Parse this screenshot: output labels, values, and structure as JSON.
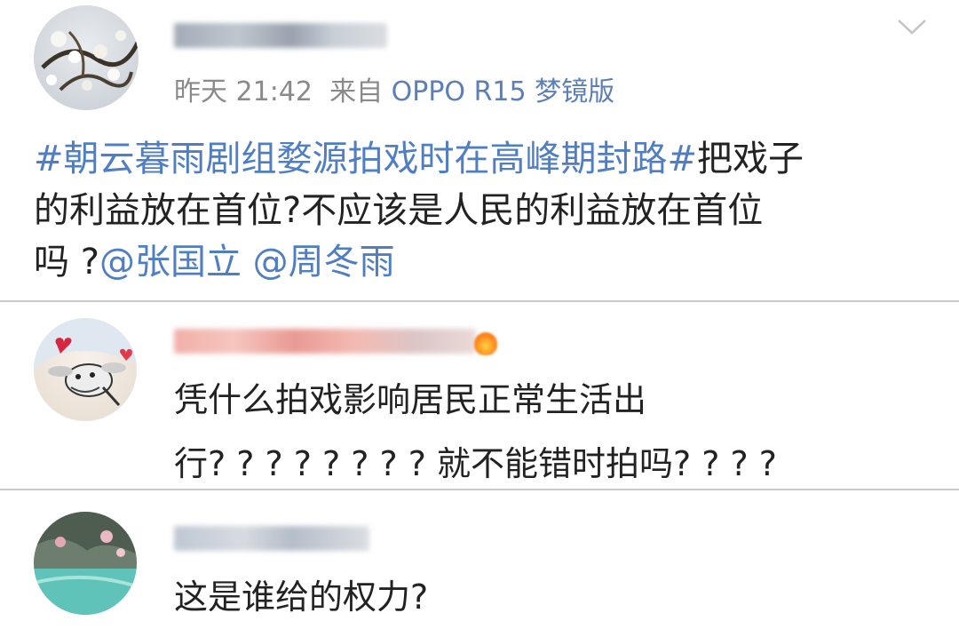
{
  "post": {
    "time": "昨天 21:42",
    "source_prefix": "来自",
    "device": "OPPO R15 梦镜版",
    "hashtag": "#朝云暮雨剧组婺源拍戏时在高峰期封路#",
    "text_after_hashtag": "把戏子",
    "line2": "的利益放在首位?不应该是人民的利益放在首位",
    "line3_prefix": "吗 ?",
    "mention1": "@张国立",
    "mention2": "@周冬雨"
  },
  "comments": [
    {
      "line1": "凭什么拍戏影响居民正常生活出",
      "line2": "行? ? ? ? ? ? ? ? 就不能错时拍吗? ? ? ?"
    },
    {
      "line1": "这是谁给的权力?"
    }
  ],
  "icons": {
    "expand": "chevron-down-icon",
    "badge": "fire-badge-icon"
  },
  "colors": {
    "link": "#4f7fc2",
    "meta": "#8a8a8a",
    "divider": "#c9c9c9"
  }
}
